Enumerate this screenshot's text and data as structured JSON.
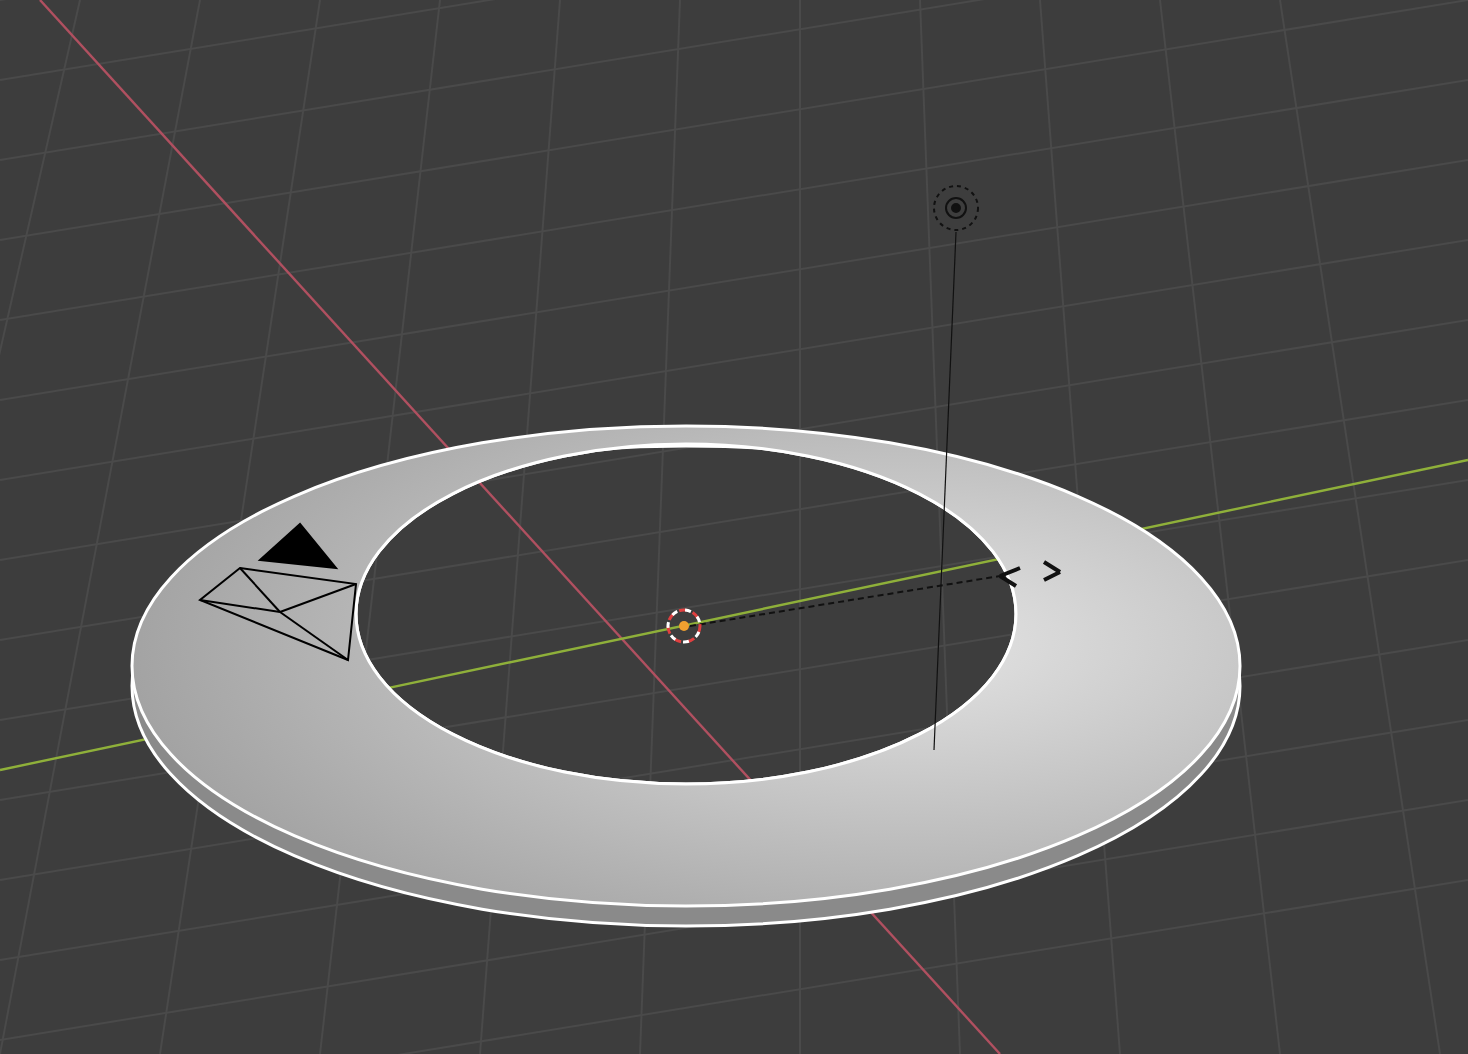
{
  "scene": {
    "objects": [
      {
        "kind": "torus",
        "selected": true
      },
      {
        "kind": "camera",
        "selected": false
      },
      {
        "kind": "light",
        "selected": false
      }
    ]
  }
}
